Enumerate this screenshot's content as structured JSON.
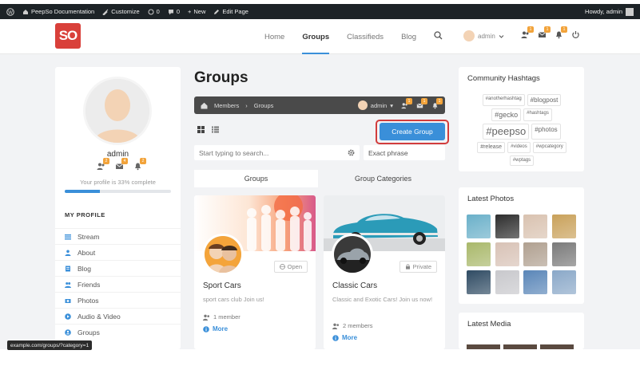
{
  "adminbar": {
    "site_name": "PeepSo Documentation",
    "customize": "Customize",
    "comments": "0",
    "new": "New",
    "edit_page": "Edit Page",
    "greeting": "Howdy, admin"
  },
  "header": {
    "logo_text": "SO",
    "nav": [
      "Home",
      "Groups",
      "Classifieds",
      "Blog"
    ],
    "active_nav": "Groups",
    "username": "admin",
    "badges": [
      "1",
      "1",
      "1"
    ]
  },
  "profile": {
    "name": "admin",
    "complete_text": "Your profile is 33% complete",
    "complete_fraction": 0.33,
    "badges": [
      "2",
      "4",
      "2"
    ],
    "section_title": "MY PROFILE",
    "menu": [
      "Stream",
      "About",
      "Blog",
      "Friends",
      "Photos",
      "Audio & Video",
      "Groups"
    ]
  },
  "main": {
    "title": "Groups",
    "breadcrumb": [
      "Members",
      "Groups"
    ],
    "bar_user": "admin",
    "bar_badges": [
      "1",
      "1",
      "1"
    ],
    "create_group": "Create Group",
    "search_placeholder": "Start typing to search...",
    "exact_phrase": "Exact phrase",
    "tabs": [
      "Groups",
      "Group Categories"
    ],
    "groups": [
      {
        "name": "Sport Cars",
        "privacy": "Open",
        "description": "sport cars club Join us!",
        "members": "1 member",
        "more": "More"
      },
      {
        "name": "Classic Cars",
        "privacy": "Private",
        "description": "Classic and Exotic Cars! Join us now!",
        "members": "2 members",
        "more": "More"
      }
    ]
  },
  "sidebar_right": {
    "hashtags_title": "Community Hashtags",
    "hashtags": [
      {
        "tag": "#anotherhashtag",
        "size": 6
      },
      {
        "tag": "#blogpost",
        "size": 8
      },
      {
        "tag": "#gecko",
        "size": 9
      },
      {
        "tag": "#hashtags",
        "size": 6
      },
      {
        "tag": "#peepso",
        "size": 13
      },
      {
        "tag": "#photos",
        "size": 8
      },
      {
        "tag": "#release",
        "size": 7
      },
      {
        "tag": "#videos",
        "size": 6
      },
      {
        "tag": "#wpcategory",
        "size": 6
      },
      {
        "tag": "#wptags",
        "size": 6
      }
    ],
    "photos_title": "Latest Photos",
    "photos": [
      "#6ab0c9",
      "#2d2d2d",
      "#d9c2b0",
      "#c9a15a",
      "#a9b86a",
      "#d8c2b6",
      "#b0a090",
      "#7a7a7a",
      "#2f4b63",
      "#c8c8cc",
      "#5a86b8",
      "#8aa8c8"
    ],
    "media_title": "Latest Media"
  },
  "statusbar": {
    "url": "example.com/groups/?category=1"
  },
  "colors": {
    "accent": "#3a8fd9",
    "logo": "#d9403a",
    "highlight": "#d23c3c",
    "badge": "#f2a33a"
  }
}
